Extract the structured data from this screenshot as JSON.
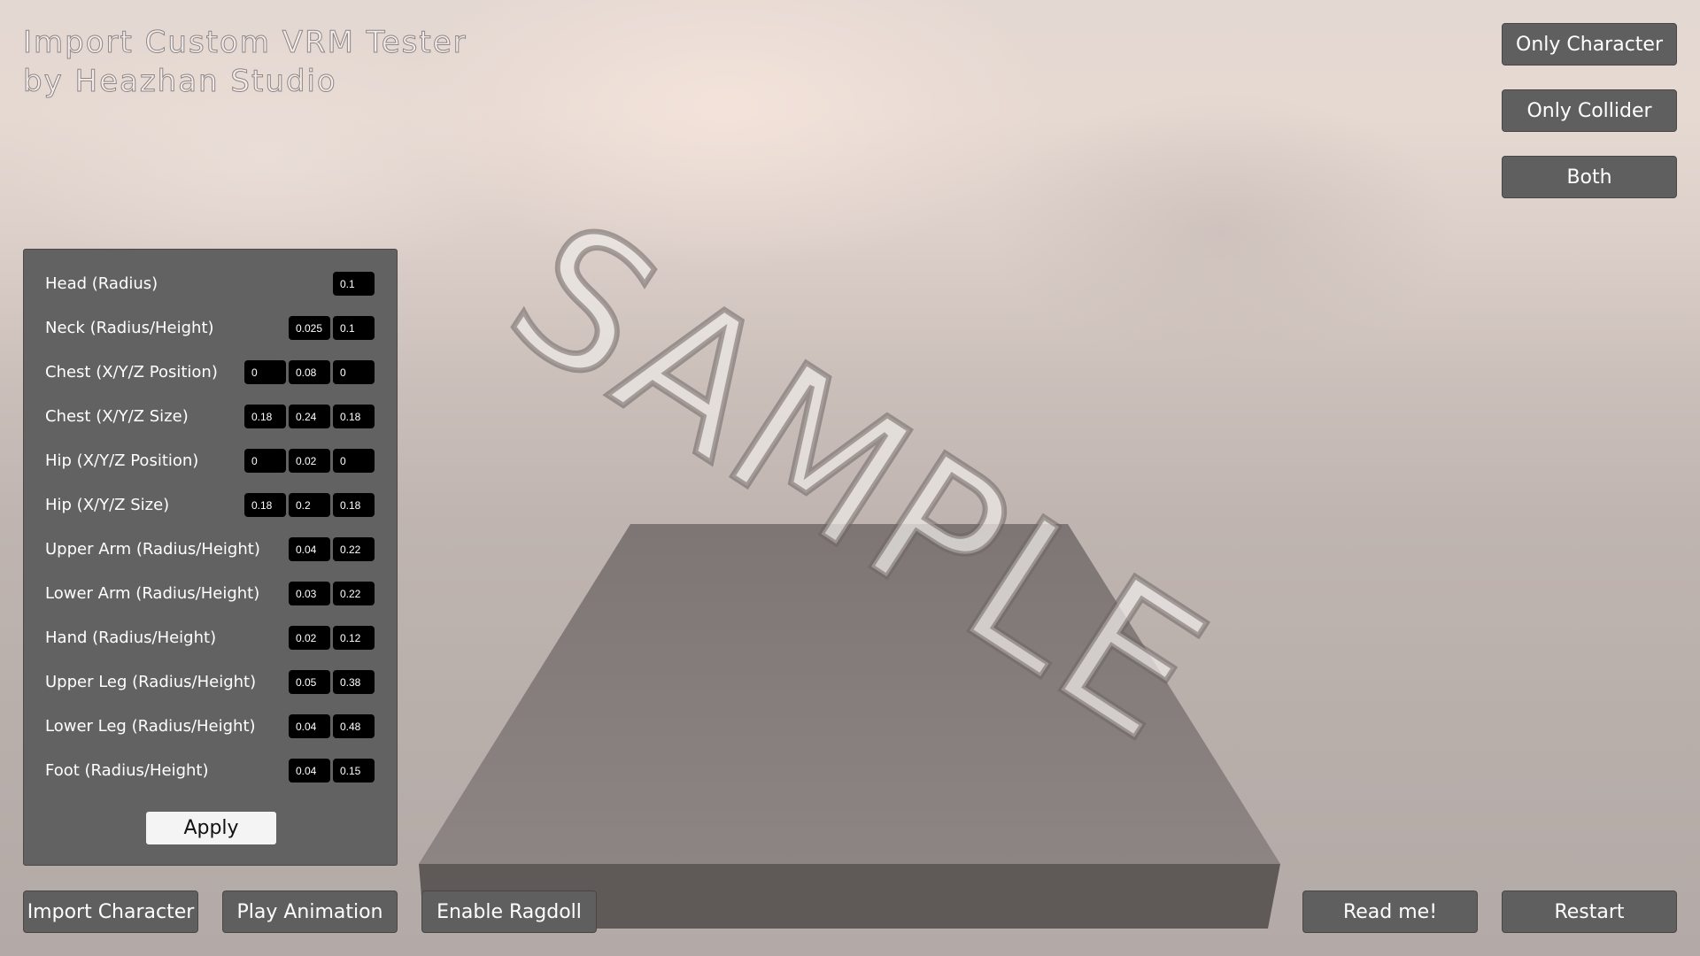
{
  "app": {
    "title_line1": "Import Custom VRM Tester",
    "title_line2": "by Heazhan Studio"
  },
  "view_mode_buttons": [
    {
      "label": "Only Character"
    },
    {
      "label": "Only Collider"
    },
    {
      "label": "Both"
    }
  ],
  "collider_panel": {
    "rows": [
      {
        "label": "Head (Radius)",
        "values": [
          "0.1"
        ]
      },
      {
        "label": "Neck (Radius/Height)",
        "values": [
          "0.025",
          "0.1"
        ]
      },
      {
        "label": "Chest (X/Y/Z Position)",
        "values": [
          "0",
          "0.08",
          "0"
        ]
      },
      {
        "label": "Chest (X/Y/Z Size)",
        "values": [
          "0.18",
          "0.24",
          "0.18"
        ]
      },
      {
        "label": "Hip (X/Y/Z Position)",
        "values": [
          "0",
          "0.02",
          "0"
        ]
      },
      {
        "label": "Hip (X/Y/Z Size)",
        "values": [
          "0.18",
          "0.2",
          "0.18"
        ]
      },
      {
        "label": "Upper Arm (Radius/Height)",
        "values": [
          "0.04",
          "0.22"
        ]
      },
      {
        "label": "Lower Arm (Radius/Height)",
        "values": [
          "0.03",
          "0.22"
        ]
      },
      {
        "label": "Hand (Radius/Height)",
        "values": [
          "0.02",
          "0.12"
        ]
      },
      {
        "label": "Upper Leg (Radius/Height)",
        "values": [
          "0.05",
          "0.38"
        ]
      },
      {
        "label": "Lower Leg (Radius/Height)",
        "values": [
          "0.04",
          "0.48"
        ]
      },
      {
        "label": "Foot (Radius/Height)",
        "values": [
          "0.04",
          "0.15"
        ]
      }
    ],
    "apply_label": "Apply"
  },
  "bottom_buttons": {
    "import_character": "Import Character",
    "play_animation": "Play Animation",
    "enable_ragdoll": "Enable Ragdoll",
    "read_me": "Read me!",
    "restart": "Restart"
  },
  "watermark": "SAMPLE",
  "colors": {
    "button_bg": "#5f5f5f",
    "panel_bg": "#626262",
    "field_bg": "#000000",
    "platform_top": "#877f7d",
    "platform_front": "#5f5a58"
  }
}
